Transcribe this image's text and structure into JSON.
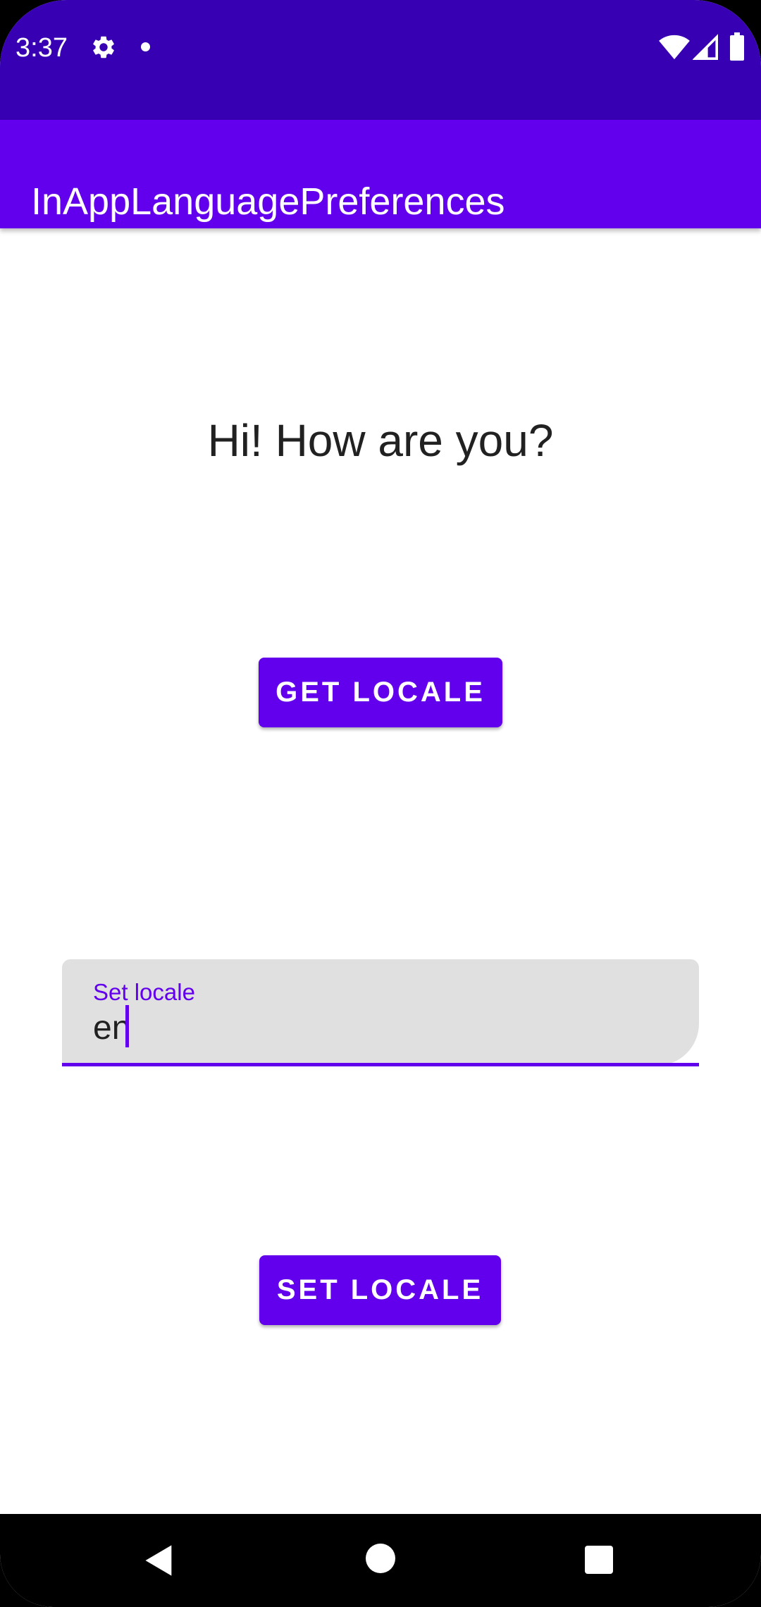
{
  "status_bar": {
    "time": "3:37",
    "icons": [
      "gear-icon",
      "notification-dot-icon",
      "wifi-icon",
      "signal-icon",
      "battery-icon"
    ]
  },
  "app_bar": {
    "title": "InAppLanguagePreferences"
  },
  "main": {
    "greeting": "Hi! How are you?",
    "get_locale_button": "GET LOCALE",
    "locale_field": {
      "label": "Set locale",
      "value": "en"
    },
    "set_locale_button": "SET LOCALE"
  },
  "nav_bar": {
    "icons": [
      "back-icon",
      "home-icon",
      "recents-icon"
    ]
  },
  "colors": {
    "status_bar": "#3700b3",
    "primary": "#6200ee",
    "field_background": "#e0e0e0",
    "text": "#212121"
  }
}
